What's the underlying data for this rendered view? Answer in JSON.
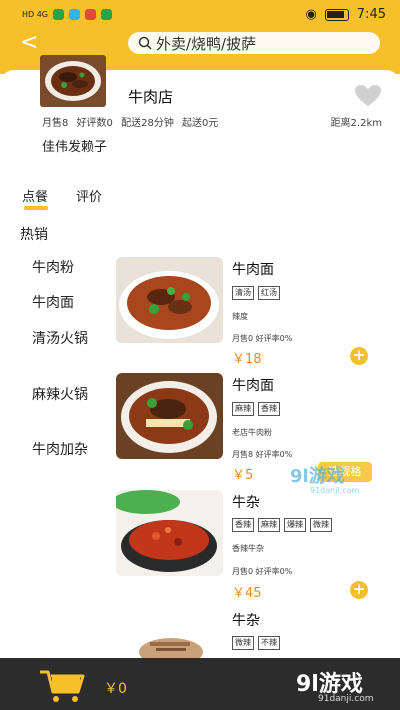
{
  "status_bar": {
    "network": "HD 4G",
    "time": "7:45"
  },
  "header": {
    "search_placeholder": "外卖/烧鸭/披萨"
  },
  "shop": {
    "name": "牛肉店",
    "monthly_sales": "月售8",
    "good_reviews": "好评数0",
    "delivery_time": "配送28分钟",
    "delivery_start": "起送0元",
    "distance": "距离2.2km",
    "notice": "佳伟发赖子"
  },
  "tabs": [
    {
      "label": "点餐"
    },
    {
      "label": "评价"
    }
  ],
  "section_title": "热销",
  "categories": [
    {
      "label": "牛肉粉"
    },
    {
      "label": "牛肉面"
    },
    {
      "label": "清汤火锅"
    },
    {
      "label": "麻辣火锅"
    },
    {
      "label": "牛肉加杂"
    }
  ],
  "dishes": [
    {
      "title": "牛肉面",
      "tags": [
        "清汤",
        "红汤"
      ],
      "desc": "辣度",
      "stats": "月售0  好评率0%",
      "price": "￥18"
    },
    {
      "title": "牛肉面",
      "tags": [
        "麻辣",
        "香辣"
      ],
      "desc": "老店牛肉粉",
      "stats": "月售8  好评率0%",
      "price": "￥5",
      "spec_label": "选规格"
    },
    {
      "title": "牛杂",
      "tags": [
        "香辣",
        "麻辣",
        "爆辣",
        "微辣"
      ],
      "desc": "香辣牛杂",
      "stats": "月售0  好评率0%",
      "price": "￥45"
    },
    {
      "title": "牛杂",
      "tags": [
        "微辣",
        "不辣"
      ]
    }
  ],
  "cart": {
    "total": "￥0"
  },
  "watermark": {
    "text": "9l游戏",
    "url": "91danji.com"
  },
  "colors": {
    "accent": "#f6c02b",
    "price": "#f08a24",
    "bottom_bar": "#2c2c2c"
  }
}
